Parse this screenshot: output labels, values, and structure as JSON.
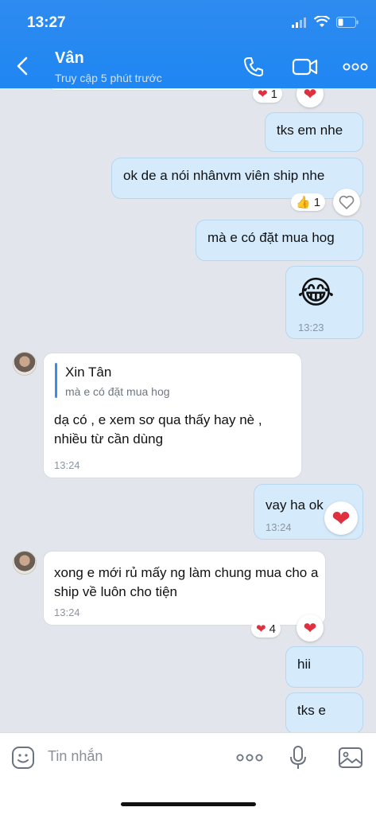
{
  "status": {
    "time": "13:27"
  },
  "header": {
    "title": "Vân",
    "subtitle": "Truy cập 5 phút trước"
  },
  "messages": {
    "m0": {
      "reaction_count": "1"
    },
    "m1": {
      "text": "tks em nhe"
    },
    "m2": {
      "text": "ok de a nói nhânvm viên ship nhe",
      "reaction_count": "1"
    },
    "m3": {
      "text": "mà e có đặt mua hog"
    },
    "m4": {
      "emoji": "😂",
      "time": "13:23"
    },
    "m5": {
      "quote_author": "Xin Tân",
      "quote_text": "mà e có đặt mua hog",
      "text": "dạ có , e xem sơ qua thấy hay nè , nhiều từ cần dùng",
      "time": "13:24"
    },
    "m6": {
      "text": "vay ha ok",
      "time": "13:24"
    },
    "m7": {
      "text": "xong e mới rủ mấy ng làm chung mua cho a ship về luôn cho tiện",
      "time": "13:24",
      "reaction_count": "4"
    },
    "m8": {
      "text": "hii"
    },
    "m9": {
      "text": "tks e"
    }
  },
  "input": {
    "placeholder": "Tin nhắn"
  },
  "colors": {
    "header": "#1f86f2",
    "outgoing": "#d5ebfc",
    "incoming": "#ffffff",
    "heart": "#e02f3f"
  }
}
